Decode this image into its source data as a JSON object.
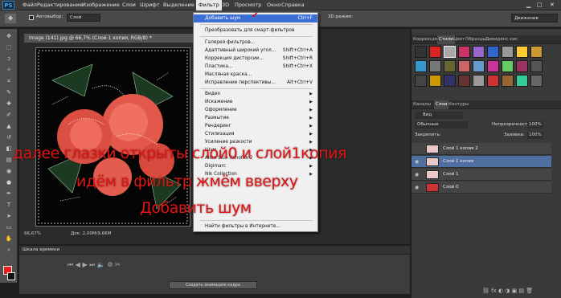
{
  "app": {
    "logo": "PS"
  },
  "menubar": [
    "Файл",
    "Редактирование",
    "Изображение",
    "Слои",
    "Шрифт",
    "Выделение",
    "Фильтр",
    "3D",
    "Просмотр",
    "Окно",
    "Справка"
  ],
  "options_bar": {
    "autoselect_label": "Автовыбор:",
    "autoselect_value": "Слой",
    "mode_label": "3D-режим:",
    "workspace": "Движение"
  },
  "document": {
    "tab_title": "image (141).jpg @ 66,7% (Слой 1 копия, RGB/8) *",
    "zoom": "66,67%",
    "doc_size": "Док: 2,00M/9,66M"
  },
  "filter_menu": {
    "items": [
      {
        "label": "Добавить шум",
        "shortcut": "Ctrl+F",
        "highlight": true
      },
      {
        "label": "Преобразовать для смарт-фильтров",
        "shortcut": ""
      },
      {
        "label": "Галерея фильтров...",
        "shortcut": ""
      },
      {
        "label": "Адаптивный широкий угол...",
        "shortcut": "Shift+Ctrl+A"
      },
      {
        "label": "Коррекция дисторсии...",
        "shortcut": "Shift+Ctrl+R"
      },
      {
        "label": "Пластика...",
        "shortcut": "Shift+Ctrl+X"
      },
      {
        "label": "Масляная краска...",
        "shortcut": ""
      },
      {
        "label": "Исправление перспективы...",
        "shortcut": "Alt+Ctrl+V"
      },
      {
        "label": "Видео",
        "sub": true
      },
      {
        "label": "Искажение",
        "sub": true
      },
      {
        "label": "Оформление",
        "sub": true
      },
      {
        "label": "Размытие",
        "sub": true
      },
      {
        "label": "Рендеринг",
        "sub": true
      },
      {
        "label": "Стилизация",
        "sub": true
      },
      {
        "label": "Усиление резкости",
        "sub": true
      },
      {
        "label": "Шум",
        "sub": true
      },
      {
        "label": "Alien Skin Xenofex 2",
        "sub": true
      },
      {
        "label": "Digimarc",
        "sub": true
      },
      {
        "label": "Nik Collection",
        "sub": true
      },
      {
        "label": "Найти фильтры в Интернете...",
        "shortcut": ""
      }
    ]
  },
  "panels": {
    "top_tabs": [
      "Коррекция",
      "Стили",
      "Цвет",
      "Образцы",
      "Дивиденс кис"
    ],
    "layers_tabs": [
      "Каналы",
      "Слои",
      "Контуры"
    ],
    "kind_label": "Вид",
    "blend_mode": "Обычные",
    "opacity_label": "Непрозрачность:",
    "opacity_value": "100%",
    "lock_label": "Закрепить:",
    "fill_label": "Заливка:",
    "fill_value": "100%",
    "layers": [
      {
        "name": "Слой 1 копия 2",
        "visible": false,
        "selected": false
      },
      {
        "name": "Слой 1 копия",
        "visible": true,
        "selected": true
      },
      {
        "name": "Слой 1",
        "visible": true,
        "selected": false
      },
      {
        "name": "Слой 0",
        "visible": true,
        "selected": false
      }
    ]
  },
  "timeline": {
    "title": "Шкала времени",
    "create_button": "Создать анимацию кадра"
  },
  "overlay_text": {
    "line1": "далее глазки открыты слой0 и слой1копия",
    "line2": "идём в фильтр жмём вверху",
    "line3": "Добавить шум"
  },
  "colors": {
    "accent": "#3b6fd6",
    "overlay_text": "#e01414",
    "foreground": "#e81e1e",
    "background": "#111111"
  }
}
